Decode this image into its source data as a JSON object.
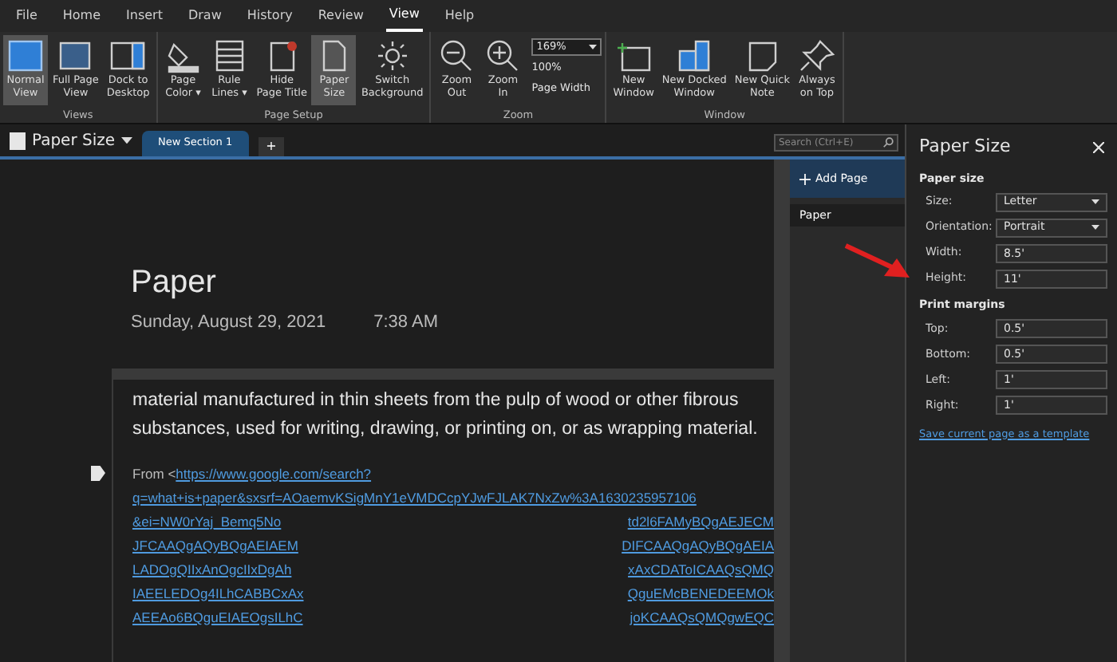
{
  "menu_tabs": [
    {
      "label": "File",
      "selected": false
    },
    {
      "label": "Home",
      "selected": false
    },
    {
      "label": "Insert",
      "selected": false
    },
    {
      "label": "Draw",
      "selected": false
    },
    {
      "label": "History",
      "selected": false
    },
    {
      "label": "Review",
      "selected": false
    },
    {
      "label": "View",
      "selected": true
    },
    {
      "label": "Help",
      "selected": false
    }
  ],
  "ribbon_groups": [
    {
      "label": "Views",
      "buttons": [
        {
          "kind": "normal-view",
          "lines": [
            "Normal",
            "View"
          ],
          "selected": true
        },
        {
          "kind": "full-page",
          "lines": [
            "Full Page",
            "View"
          ],
          "selected": false
        },
        {
          "kind": "dock",
          "lines": [
            "Dock to",
            "Desktop"
          ],
          "selected": false
        }
      ]
    },
    {
      "label": "Page Setup",
      "buttons": [
        {
          "kind": "page-color",
          "lines": [
            "Page",
            "Color ▾"
          ],
          "selected": false
        },
        {
          "kind": "rule-lines",
          "lines": [
            "Rule",
            "Lines ▾"
          ],
          "selected": false
        },
        {
          "kind": "hide-title",
          "lines": [
            "Hide",
            "Page Title"
          ],
          "selected": false
        },
        {
          "kind": "paper-size",
          "lines": [
            "Paper",
            "Size"
          ],
          "selected": true
        },
        {
          "kind": "switch-bg",
          "lines": [
            "Switch",
            "Background"
          ],
          "selected": false
        }
      ]
    },
    {
      "label": "Zoom",
      "buttons": [
        {
          "kind": "zoom-out",
          "lines": [
            "Zoom",
            "Out"
          ],
          "selected": false
        },
        {
          "kind": "zoom-in",
          "lines": [
            "Zoom",
            "In"
          ],
          "selected": false
        }
      ],
      "zoom_value": "169%",
      "zoom_100": "100%",
      "page_width": "Page Width"
    },
    {
      "label": "Window",
      "buttons": [
        {
          "kind": "new-window",
          "lines": [
            "New",
            "Window"
          ],
          "selected": false
        },
        {
          "kind": "docked",
          "lines": [
            "New Docked",
            "Window"
          ],
          "selected": false
        },
        {
          "kind": "quick-note",
          "lines": [
            "New Quick",
            "Note"
          ],
          "selected": false
        },
        {
          "kind": "pin",
          "lines": [
            "Always",
            "on Top"
          ],
          "selected": false
        }
      ]
    }
  ],
  "notebook": {
    "title": "Paper Size",
    "sections": [
      {
        "label": "New Section 1",
        "selected": true
      }
    ],
    "add_section": "+"
  },
  "search": {
    "placeholder": "Search (Ctrl+E)"
  },
  "page": {
    "title": "Paper",
    "date": "Sunday, August 29, 2021",
    "time": "7:38 AM",
    "paragraph": [
      "material manufactured in thin sheets from the pulp of wood or other fibrous",
      "substances, used for writing, drawing, or printing on, or as wrapping material."
    ],
    "from_label": "From <",
    "link_lines": [
      [
        "https://www.google.com/search?"
      ],
      [
        "q=what+is+paper&sxsrf=AOaemvKSigMnY1eVMDCcpYJwFJLAK7NxZw%3A1630235957106"
      ],
      [
        "&ei=NW0rYaj_Bemq5No",
        "td2l6FAMyBQgAEJECM"
      ],
      [
        "JFCAAQgAQyBQgAEIAEM",
        "DIFCAAQgAQyBQgAEIA"
      ],
      [
        "LADOgQIIxAnOgcIIxDgAh",
        "xAxCDAToICAAQsQMQ"
      ],
      [
        "IAEELEDOg4ILhCABBCxAx",
        "QguEMcBENEDEEMOk"
      ],
      [
        "AEEAo6BQguEIAEOgsILhC",
        "joKCAAQsQMQgwEQC"
      ]
    ]
  },
  "pages_panel": {
    "add_page": "Add Page",
    "pages": [
      {
        "label": "Paper",
        "selected": true
      }
    ]
  },
  "pane": {
    "title": "Paper Size",
    "paper_size_heading": "Paper size",
    "size_fields": [
      {
        "label": "Size:",
        "value": "Letter",
        "kind": "dropdown"
      },
      {
        "label": "Orientation:",
        "value": "Portrait",
        "kind": "dropdown"
      },
      {
        "label": "Width:",
        "value": "8.5'",
        "kind": "text"
      },
      {
        "label": "Height:",
        "value": "11'",
        "kind": "text"
      }
    ],
    "margins_heading": "Print margins",
    "margin_fields": [
      {
        "label": "Top:",
        "value": "0.5'",
        "kind": "text"
      },
      {
        "label": "Bottom:",
        "value": "0.5'",
        "kind": "text"
      },
      {
        "label": "Left:",
        "value": "1'",
        "kind": "text"
      },
      {
        "label": "Right:",
        "value": "1'",
        "kind": "text"
      }
    ],
    "template_link": "Save current page as a template"
  }
}
